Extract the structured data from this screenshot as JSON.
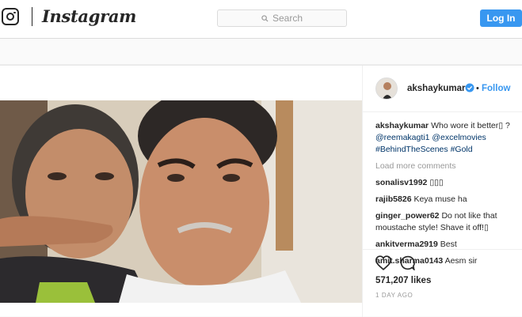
{
  "header": {
    "brand": "Instagram",
    "search_placeholder": "Search",
    "login_label": "Log In"
  },
  "post": {
    "owner": "akshaykumar",
    "verified": true,
    "separator": "•",
    "follow_label": "Follow",
    "caption": {
      "user": "akshaykumar",
      "text": "Who wore it better▯ ?",
      "mention_1": "@reemakagti1",
      "mention_2": "@excelmovies",
      "hashtag_1": "#BehindTheScenes",
      "hashtag_2": "#Gold"
    },
    "load_more": "Load more comments",
    "comments": [
      {
        "user": "sonalisv1992",
        "text": "▯▯▯"
      },
      {
        "user": "rajib5826",
        "text": "Keya muse ha"
      },
      {
        "user": "ginger_power62",
        "text": "Do not like that moustache style! Shave it off!▯"
      },
      {
        "user": "ankitverma2919",
        "text": "Best"
      },
      {
        "user": "amit.sharma0143",
        "text": "Aesm sir"
      }
    ],
    "likes": "571,207 likes",
    "time_ago": "1 DAY AGO"
  },
  "colors": {
    "accent": "#3897f0",
    "link": "#003569",
    "muted": "#999999"
  },
  "icons": [
    "instagram-glyph-icon",
    "search-icon",
    "verified-badge-icon",
    "heart-icon",
    "comment-bubble-icon"
  ]
}
